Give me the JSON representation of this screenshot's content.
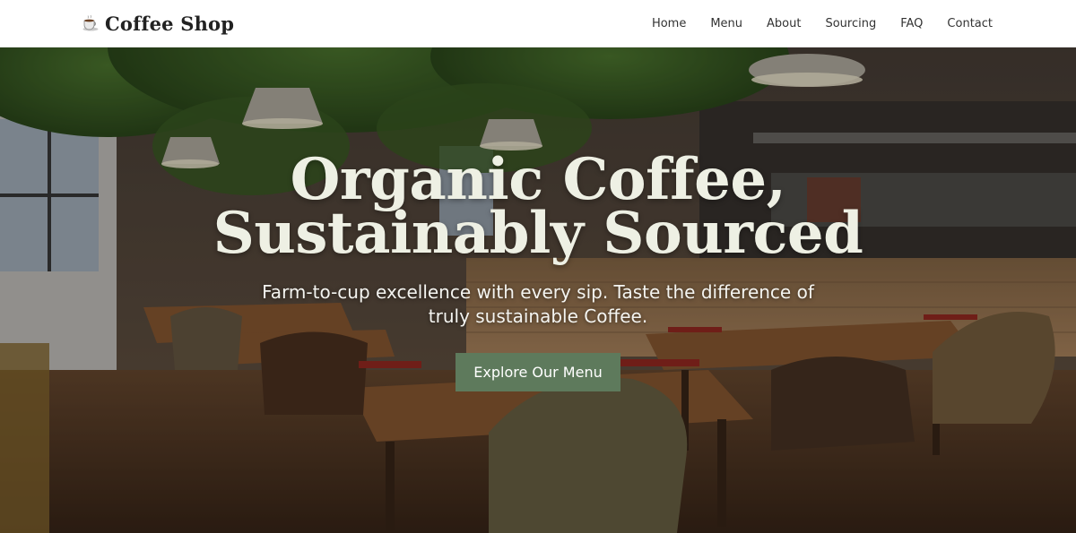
{
  "brand": {
    "icon": "coffee-cup-icon",
    "name": "Coffee Shop"
  },
  "nav": {
    "items": [
      {
        "label": "Home"
      },
      {
        "label": "Menu"
      },
      {
        "label": "About"
      },
      {
        "label": "Sourcing"
      },
      {
        "label": "FAQ"
      },
      {
        "label": "Contact"
      }
    ]
  },
  "hero": {
    "title_line1": "Organic Coffee,",
    "title_line2": "Sustainably Sourced",
    "subtitle": "Farm-to-cup excellence with every sip. Taste the difference of truly sustainable Coffee.",
    "cta_label": "Explore Our Menu"
  },
  "colors": {
    "cta_bg": "#5e7a5c",
    "title_text": "#eef0e4",
    "header_bg": "#ffffff"
  }
}
